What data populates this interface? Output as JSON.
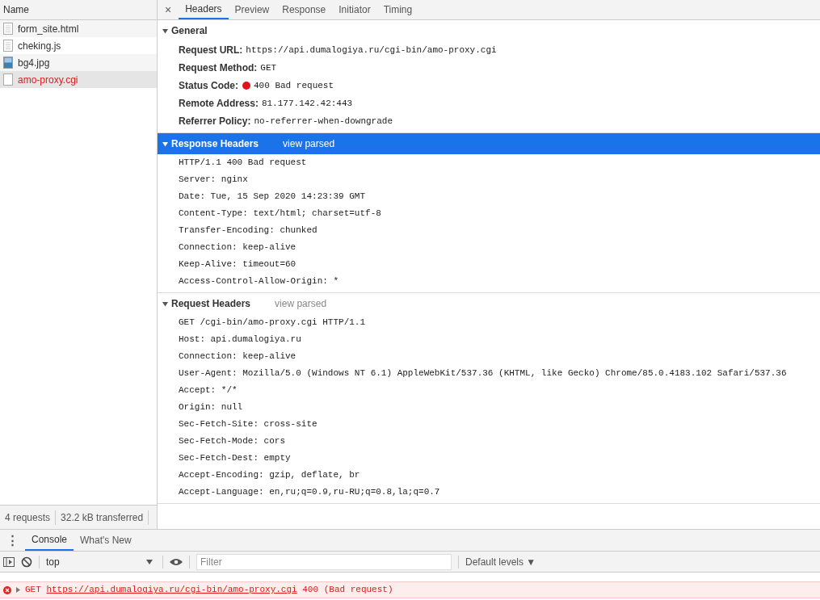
{
  "requests_panel": {
    "column_header": "Name",
    "items": [
      {
        "name": "form_site.html",
        "kind": "document",
        "selected": false,
        "failed": false
      },
      {
        "name": "cheking.js",
        "kind": "document",
        "selected": false,
        "failed": false
      },
      {
        "name": "bg4.jpg",
        "kind": "image",
        "selected": false,
        "failed": false
      },
      {
        "name": "amo-proxy.cgi",
        "kind": "blank",
        "selected": true,
        "failed": true
      }
    ],
    "summary": [
      "4 requests",
      "32.2 kB transferred"
    ]
  },
  "detail_tabs": {
    "close": "×",
    "tabs": [
      {
        "label": "Headers",
        "selected": true
      },
      {
        "label": "Preview",
        "selected": false
      },
      {
        "label": "Response",
        "selected": false
      },
      {
        "label": "Initiator",
        "selected": false
      },
      {
        "label": "Timing",
        "selected": false
      }
    ]
  },
  "sections": [
    {
      "kind": "fields",
      "title": "General",
      "expanded": true,
      "selected": false,
      "fields": [
        {
          "label": "Request URL:",
          "value": "https://api.dumalogiya.ru/cgi-bin/amo-proxy.cgi",
          "error": false
        },
        {
          "label": "Request Method:",
          "value": "GET",
          "error": false
        },
        {
          "label": "Status Code:",
          "value": "400 Bad request",
          "error": true
        },
        {
          "label": "Remote Address:",
          "value": "81.177.142.42:443",
          "error": false
        },
        {
          "label": "Referrer Policy:",
          "value": "no-referrer-when-downgrade",
          "error": false
        }
      ]
    },
    {
      "kind": "raw",
      "title": "Response Headers",
      "expanded": true,
      "selected": true,
      "link": "view parsed",
      "lines": [
        "HTTP/1.1 400 Bad request",
        "Server: nginx",
        "Date: Tue, 15 Sep 2020 14:23:39 GMT",
        "Content-Type: text/html; charset=utf-8",
        "Transfer-Encoding: chunked",
        "Connection: keep-alive",
        "Keep-Alive: timeout=60",
        "Access-Control-Allow-Origin: *"
      ]
    },
    {
      "kind": "raw",
      "title": "Request Headers",
      "expanded": true,
      "selected": false,
      "link": "view parsed",
      "lines": [
        "GET /cgi-bin/amo-proxy.cgi HTTP/1.1",
        "Host: api.dumalogiya.ru",
        "Connection: keep-alive",
        "User-Agent: Mozilla/5.0 (Windows NT 6.1) AppleWebKit/537.36 (KHTML, like Gecko) Chrome/85.0.4183.102 Safari/537.36",
        "Accept: */*",
        "Origin: null",
        "Sec-Fetch-Site: cross-site",
        "Sec-Fetch-Mode: cors",
        "Sec-Fetch-Dest: empty",
        "Accept-Encoding: gzip, deflate, br",
        "Accept-Language: en,ru;q=0.9,ru-RU;q=0.8,la;q=0.7"
      ]
    }
  ],
  "drawer": {
    "menu": "⋮",
    "tabs": [
      {
        "label": "Console",
        "selected": true
      },
      {
        "label": "What's New",
        "selected": false
      }
    ],
    "context": "top",
    "filter": {
      "placeholder": "Filter"
    },
    "levels": "Default levels ▼",
    "messages": [
      {
        "kind": "error",
        "method": "GET",
        "url": "https://api.dumalogiya.ru/cgi-bin/amo-proxy.cgi",
        "status": "400 (Bad request)"
      }
    ]
  }
}
